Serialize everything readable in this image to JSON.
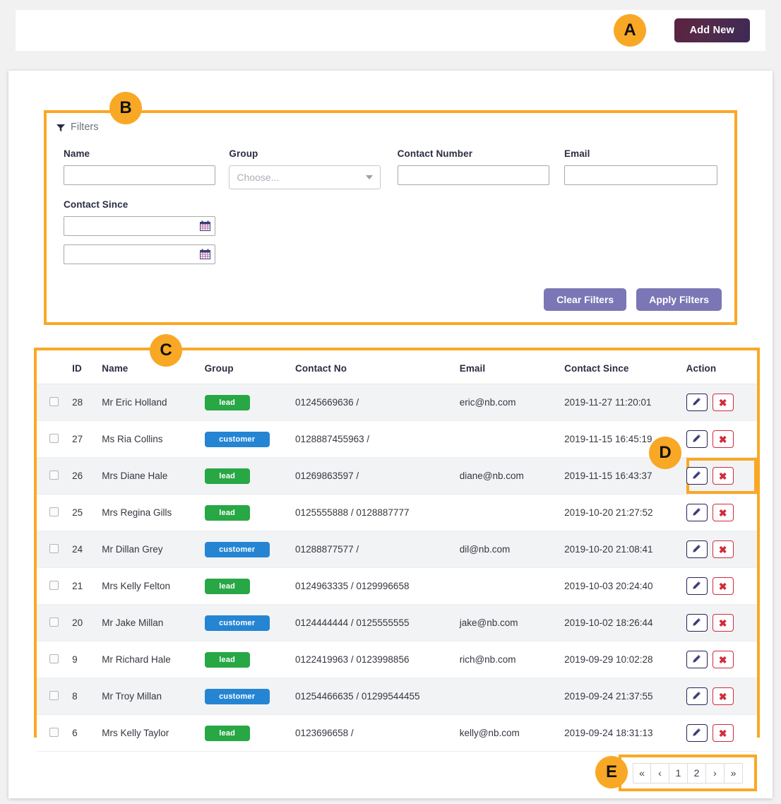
{
  "topbar": {
    "add_new_label": "Add New"
  },
  "filters": {
    "title": "Filters",
    "funnel_icon": "funnel-icon",
    "fields": {
      "name": {
        "label": "Name",
        "value": "",
        "placeholder": ""
      },
      "group": {
        "label": "Group",
        "placeholder": "Choose...",
        "value": ""
      },
      "contact_number": {
        "label": "Contact Number",
        "value": "",
        "placeholder": ""
      },
      "email": {
        "label": "Email",
        "value": "",
        "placeholder": ""
      },
      "contact_since": {
        "label": "Contact Since",
        "from_value": "",
        "to_value": "",
        "calendar_icon": "calendar-icon"
      }
    },
    "clear_label": "Clear Filters",
    "apply_label": "Apply Filters"
  },
  "table": {
    "columns": [
      "",
      "ID",
      "Name",
      "Group",
      "Contact No",
      "Email",
      "Contact Since",
      "Action"
    ],
    "rows": [
      {
        "id": "28",
        "name": "Mr Eric Holland",
        "group": "lead",
        "contact": "01245669636 /",
        "email": "eric@nb.com",
        "since": "2019-11-27 11:20:01"
      },
      {
        "id": "27",
        "name": "Ms Ria Collins",
        "group": "customer",
        "contact": "0128887455963 /",
        "email": "",
        "since": "2019-11-15 16:45:19"
      },
      {
        "id": "26",
        "name": "Mrs Diane Hale",
        "group": "lead",
        "contact": "01269863597 /",
        "email": "diane@nb.com",
        "since": "2019-11-15 16:43:37"
      },
      {
        "id": "25",
        "name": "Mrs Regina Gills",
        "group": "lead",
        "contact": "0125555888 / 0128887777",
        "email": "",
        "since": "2019-10-20 21:27:52"
      },
      {
        "id": "24",
        "name": "Mr Dillan Grey",
        "group": "customer",
        "contact": "01288877577 /",
        "email": "dil@nb.com",
        "since": "2019-10-20 21:08:41"
      },
      {
        "id": "21",
        "name": "Mrs Kelly Felton",
        "group": "lead",
        "contact": "0124963335 / 0129996658",
        "email": "",
        "since": "2019-10-03 20:24:40"
      },
      {
        "id": "20",
        "name": "Mr Jake Millan",
        "group": "customer",
        "contact": "0124444444 / 0125555555",
        "email": "jake@nb.com",
        "since": "2019-10-02 18:26:44"
      },
      {
        "id": "9",
        "name": "Mr Richard Hale",
        "group": "lead",
        "contact": "0122419963 / 0123998856",
        "email": "rich@nb.com",
        "since": "2019-09-29 10:02:28"
      },
      {
        "id": "8",
        "name": "Mr Troy Millan",
        "group": "customer",
        "contact": "01254466635 / 01299544455",
        "email": "",
        "since": "2019-09-24 21:37:55"
      },
      {
        "id": "6",
        "name": "Mrs Kelly Taylor",
        "group": "lead",
        "contact": "0123696658 /",
        "email": "kelly@nb.com",
        "since": "2019-09-24 18:31:13"
      }
    ],
    "action_icons": {
      "edit": "pencil-icon",
      "delete": "close-x-icon"
    }
  },
  "pagination": {
    "buttons": [
      "«",
      "‹",
      "1",
      "2",
      "›",
      "»"
    ]
  },
  "annotations": {
    "a": "A",
    "b": "B",
    "c": "C",
    "d": "D",
    "e": "E"
  },
  "colors": {
    "accent_orange": "#f9a825",
    "lead_green": "#28a745",
    "customer_blue": "#2585d3",
    "primary_purple": "#7b76b5",
    "danger_red": "#d12b3c"
  }
}
